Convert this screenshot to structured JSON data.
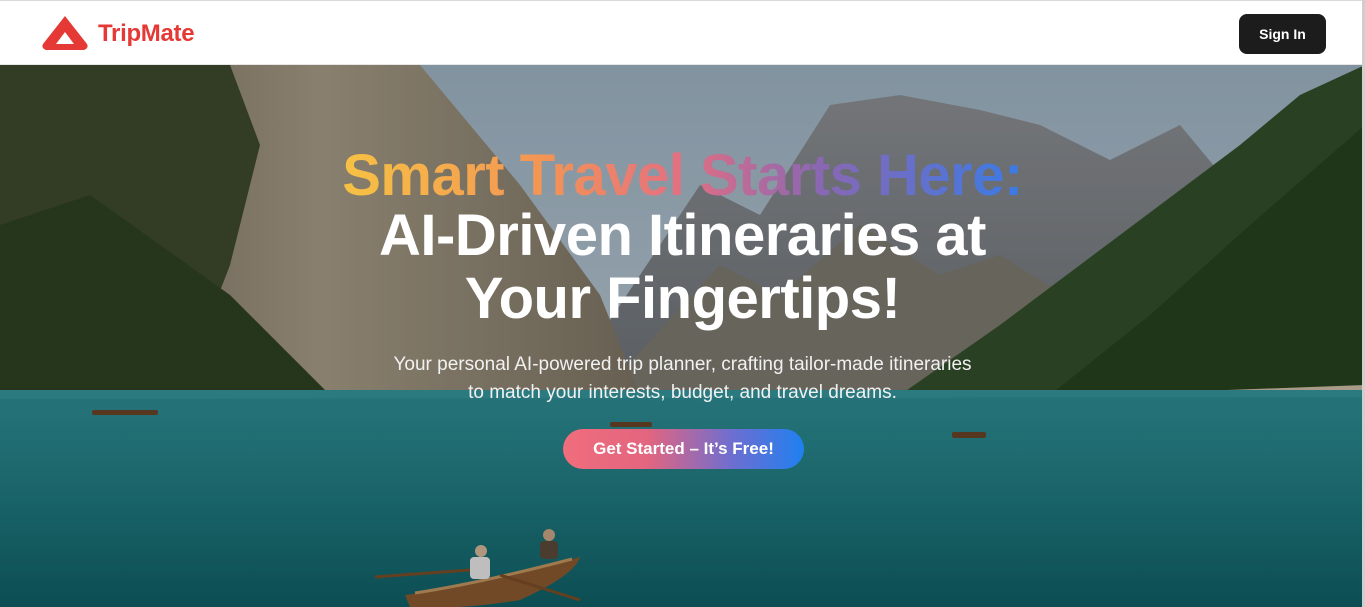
{
  "header": {
    "brand_name": "TripMate",
    "logo_icon": "triangle-logo-icon",
    "sign_in_label": "Sign In"
  },
  "hero": {
    "headline_gradient": "Smart Travel Starts Here:",
    "headline_line2": "AI-Driven Itineraries at",
    "headline_line3": "Your Fingertips!",
    "subtitle_line1": "Your personal AI-powered trip planner, crafting tailor-made itineraries",
    "subtitle_line2": "to match your interests, budget, and travel dreams.",
    "cta_label": "Get Started – It’s Free!"
  },
  "colors": {
    "brand_red": "#e53935",
    "signin_bg": "#1c1c1c",
    "cta_start": "#f06d7c",
    "cta_end": "#1f80f0",
    "headline_gradient": [
      "#f6c244",
      "#f39455",
      "#e36f82",
      "#8a67b3",
      "#3a7be6"
    ]
  }
}
